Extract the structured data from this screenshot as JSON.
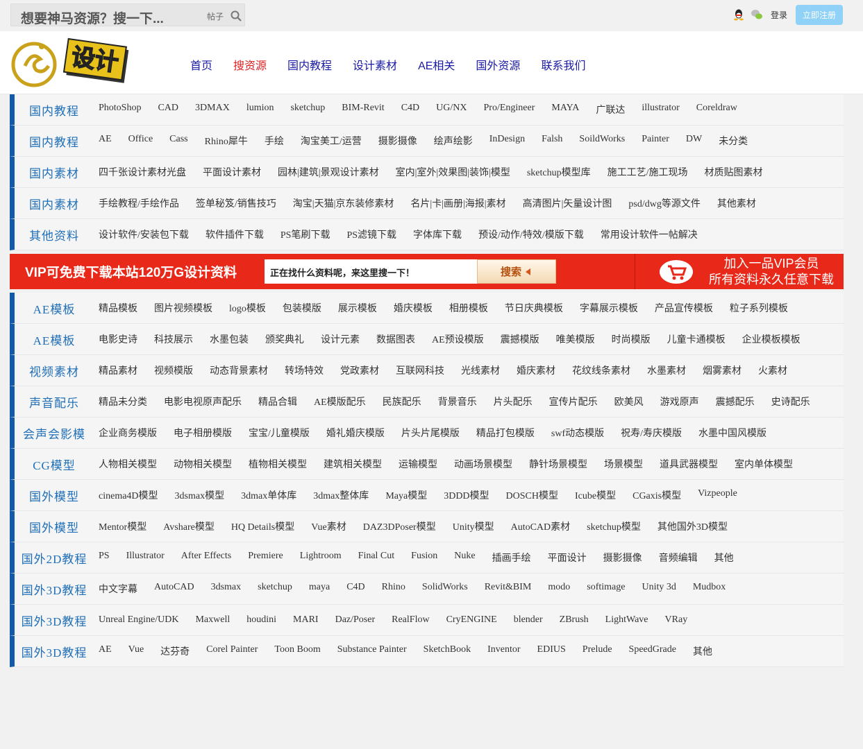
{
  "top": {
    "search_placeholder": "想要神马资源？搜一下...",
    "search_scope": "帖子",
    "login": "登录",
    "register": "立即注册"
  },
  "logo": {
    "text": "设计"
  },
  "nav": [
    "首页",
    "搜资源",
    "国内教程",
    "设计素材",
    "AE相关",
    "国外资源",
    "联系我们"
  ],
  "rows_top": [
    {
      "title": "国内教程",
      "links": [
        "PhotoShop",
        "CAD",
        "3DMAX",
        "lumion",
        "sketchup",
        "BIM-Revit",
        "C4D",
        "UG/NX",
        "Pro/Engineer",
        "MAYA",
        "广联达",
        "illustrator",
        "Coreldraw"
      ]
    },
    {
      "title": "国内教程",
      "links": [
        "AE",
        "Office",
        "Cass",
        "Rhino犀牛",
        "手绘",
        "淘宝美工/运营",
        "摄影摄像",
        "绘声绘影",
        "InDesign",
        "Falsh",
        "SoildWorks",
        "Painter",
        "DW",
        "未分类"
      ]
    },
    {
      "title": "国内素材",
      "links": [
        "四千张设计素材光盘",
        "平面设计素材",
        "园林|建筑|景观设计素材",
        "室内|室外|效果图|装饰|模型",
        "sketchup模型库",
        "施工工艺/施工现场",
        "材质贴图素材"
      ]
    },
    {
      "title": "国内素材",
      "links": [
        "手绘教程/手绘作品",
        "签单秘笈/销售技巧",
        "淘宝|天猫|京东装修素材",
        "名片|卡|画册|海报|素材",
        "高清图片|矢量设计图",
        "psd/dwg等源文件",
        "其他素材"
      ]
    },
    {
      "title": "其他资料",
      "links": [
        "设计软件/安装包下载",
        "软件插件下载",
        "PS笔刷下载",
        "PS滤镜下载",
        "字体库下载",
        "预设/动作/特效/模版下载",
        "常用设计软件一帖解决"
      ]
    }
  ],
  "banner": {
    "left_text": "VIP可免费下载本站120万G设计资料",
    "input_text": "正在找什么资料呢，来这里搜一下！",
    "search_label": "搜索",
    "vip_line1": "加入一品VIP会员",
    "vip_line2": "所有资料永久任意下载"
  },
  "rows_bottom": [
    {
      "title": "AE模板",
      "links": [
        "精品模板",
        "图片视频模板",
        "logo模板",
        "包装模版",
        "展示模板",
        "婚庆模板",
        "相册模板",
        "节日庆典模板",
        "字幕展示模板",
        "产品宣传模板",
        "粒子系列模板"
      ]
    },
    {
      "title": "AE模板",
      "links": [
        "电影史诗",
        "科技展示",
        "水墨包装",
        "颁奖典礼",
        "设计元素",
        "数据图表",
        "AE预设模版",
        "震撼模版",
        "唯美模版",
        "时尚模版",
        "儿童卡通模板",
        "企业模板模板"
      ]
    },
    {
      "title": "视频素材",
      "links": [
        "精品素材",
        "视频模版",
        "动态背景素材",
        "转场特效",
        "党政素材",
        "互联网科技",
        "光线素材",
        "婚庆素材",
        "花纹线条素材",
        "水墨素材",
        "烟雾素材",
        "火素材"
      ]
    },
    {
      "title": "声音配乐",
      "links": [
        "精品未分类",
        "电影电视原声配乐",
        "精品合辑",
        "AE模版配乐",
        "民族配乐",
        "背景音乐",
        "片头配乐",
        "宣传片配乐",
        "欧美风",
        "游戏原声",
        "震撼配乐",
        "史诗配乐"
      ]
    },
    {
      "title": "会声会影模",
      "links": [
        "企业商务模版",
        "电子相册模版",
        "宝宝/儿童模版",
        "婚礼婚庆模版",
        "片头片尾模版",
        "精品打包模版",
        "swf动态模版",
        "祝寿/寿庆模版",
        "水墨中国风模版"
      ]
    },
    {
      "title": "CG模型",
      "links": [
        "人物相关模型",
        "动物相关模型",
        "植物相关模型",
        "建筑相关模型",
        "运输模型",
        "动画场景模型",
        "静针场景模型",
        "场景模型",
        "道具武器模型",
        "室内单体模型"
      ]
    },
    {
      "title": "国外模型",
      "links": [
        "cinema4D模型",
        "3dsmax模型",
        "3dmax单体库",
        "3dmax整体库",
        "Maya模型",
        "3DDD模型",
        "DOSCH模型",
        "Icube模型",
        "CGaxis模型",
        "Vizpeople"
      ]
    },
    {
      "title": "国外模型",
      "links": [
        "Mentor模型",
        "Avshare模型",
        "HQ Details模型",
        "Vue素材",
        "DAZ3DPoser模型",
        "Unity模型",
        "AutoCAD素材",
        "sketchup模型",
        "其他国外3D模型"
      ]
    },
    {
      "title": "国外2D教程",
      "links": [
        "PS",
        "Illustrator",
        "After Effects",
        "Premiere",
        "Lightroom",
        "Final Cut",
        "Fusion",
        "Nuke",
        "插画手绘",
        "平面设计",
        "摄影摄像",
        "音频编辑",
        "其他"
      ]
    },
    {
      "title": "国外3D教程",
      "links": [
        "中文字幕",
        "AutoCAD",
        "3dsmax",
        "sketchup",
        "maya",
        "C4D",
        "Rhino",
        "SolidWorks",
        "Revit&BIM",
        "modo",
        "softimage",
        "Unity 3d",
        "Mudbox"
      ]
    },
    {
      "title": "国外3D教程",
      "links": [
        "Unreal Engine/UDK",
        "Maxwell",
        "houdini",
        "MARI",
        "Daz/Poser",
        "RealFlow",
        "CryENGINE",
        "blender",
        "ZBrush",
        "LightWave",
        "VRay"
      ]
    },
    {
      "title": "国外3D教程",
      "links": [
        "AE",
        "Vue",
        "达芬奇",
        "Corel Painter",
        "Toon Boom",
        "Substance Painter",
        "SketchBook",
        "Inventor",
        "EDIUS",
        "Prelude",
        "SpeedGrade",
        "其他"
      ]
    }
  ]
}
